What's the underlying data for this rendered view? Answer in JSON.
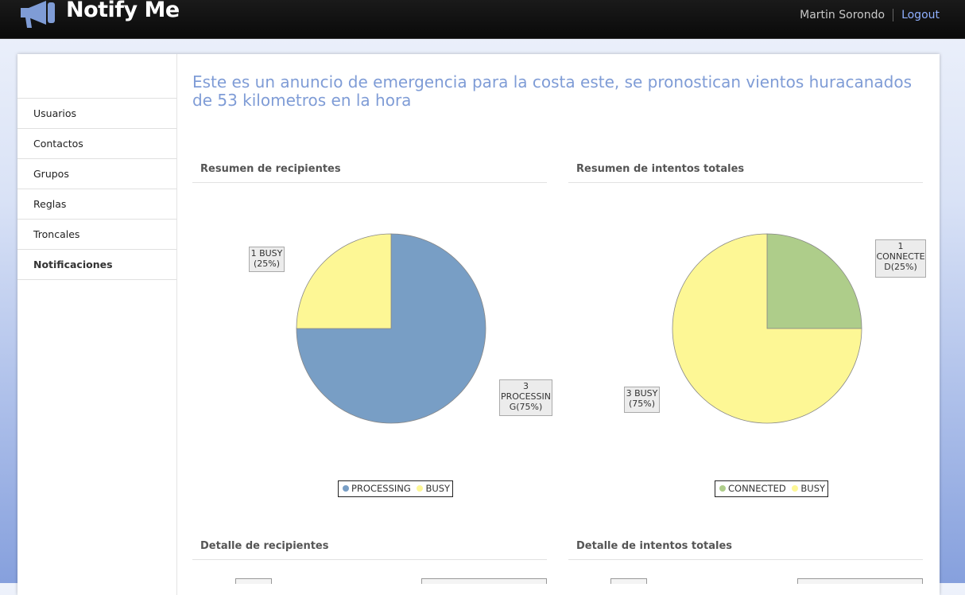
{
  "header": {
    "app_title": "Notify Me",
    "user_name": "Martin Sorondo",
    "logout_label": "Logout",
    "logo_icon": "megaphone-icon"
  },
  "sidebar": {
    "items": [
      {
        "label": "Usuarios"
      },
      {
        "label": "Contactos"
      },
      {
        "label": "Grupos"
      },
      {
        "label": "Reglas"
      },
      {
        "label": "Troncales"
      },
      {
        "label": "Notificaciones",
        "active": true
      }
    ]
  },
  "main": {
    "announcement": "Este es un anuncio de emergencia para la costa este, se pronostican vientos huracanados de 53 kilometros en la hora",
    "sections": {
      "recipients_summary": "Resumen de recipientes",
      "attempts_summary": "Resumen de intentos totales",
      "recipients_detail": "Detalle de recipientes",
      "attempts_detail": "Detalle de intentos totales"
    }
  },
  "colors": {
    "processing": "#789ec5",
    "busy": "#fdf795",
    "connected": "#aecd8a",
    "accent": "#7f9cd6"
  },
  "chart_data": [
    {
      "type": "pie",
      "slices": [
        {
          "name": "PROCESSING",
          "value": 3,
          "percent": 75,
          "label_lines": [
            "3",
            "PROCESSIN",
            "G(75%)"
          ]
        },
        {
          "name": "BUSY",
          "value": 1,
          "percent": 25,
          "label_lines": [
            "1 BUSY",
            "(25%)"
          ]
        }
      ],
      "legend": [
        "PROCESSING",
        "BUSY"
      ],
      "legend_position": "bottom-center"
    },
    {
      "type": "pie",
      "slices": [
        {
          "name": "CONNECTED",
          "value": 1,
          "percent": 25,
          "label_lines": [
            "1",
            "CONNECTE",
            "D(25%)"
          ]
        },
        {
          "name": "BUSY",
          "value": 3,
          "percent": 75,
          "label_lines": [
            "3 BUSY",
            "(75%)"
          ]
        }
      ],
      "legend": [
        "CONNECTED",
        "BUSY"
      ],
      "legend_position": "bottom-center"
    }
  ]
}
